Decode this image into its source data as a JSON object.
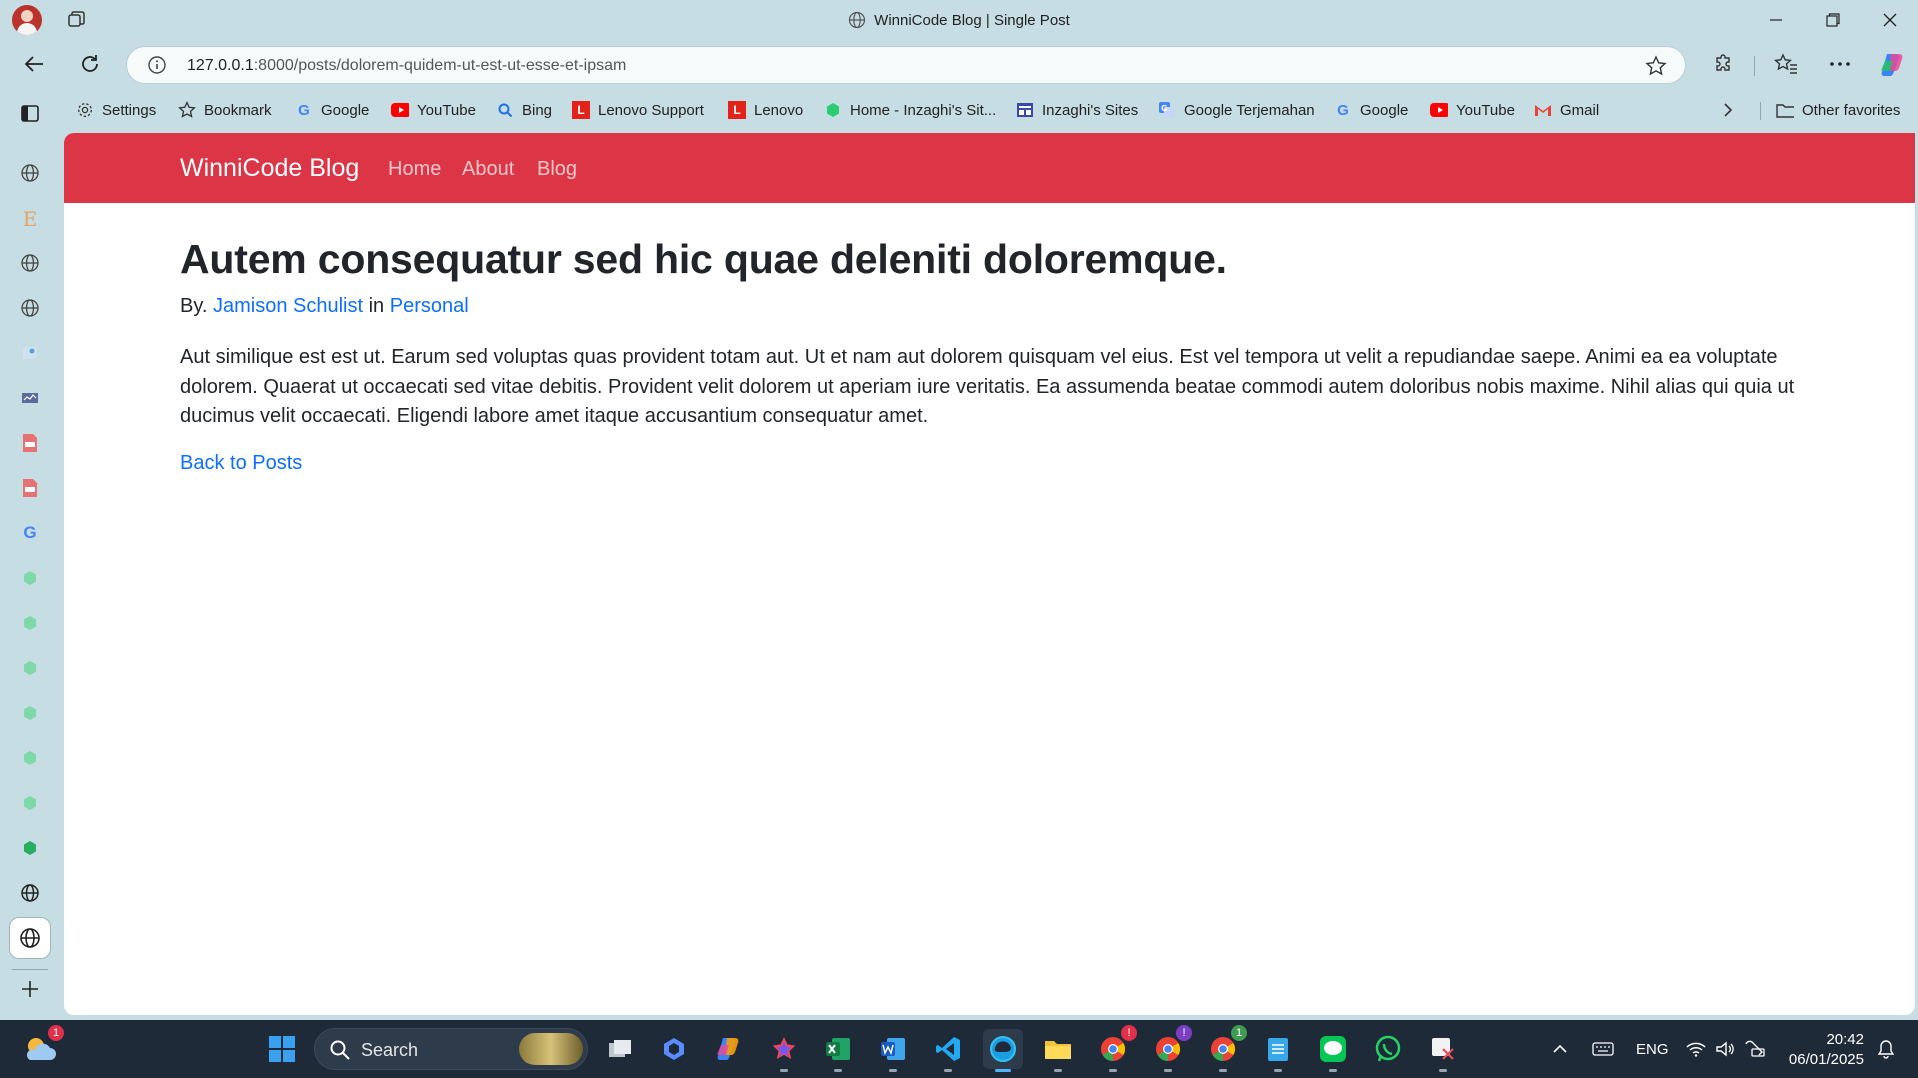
{
  "window": {
    "title": "WinniCode Blog | Single Post"
  },
  "address_bar": {
    "url_host": "127.0.0.1",
    "url_rest": ":8000/posts/dolorem-quidem-ut-est-ut-esse-et-ipsam"
  },
  "favorites": [
    {
      "label": "Settings",
      "icon": "gear-icon"
    },
    {
      "label": "Bookmark",
      "icon": "star-icon"
    },
    {
      "label": "Google",
      "icon": "google-icon"
    },
    {
      "label": "YouTube",
      "icon": "youtube-icon"
    },
    {
      "label": "Bing",
      "icon": "bing-icon"
    },
    {
      "label": "Lenovo Support",
      "icon": "lenovo-icon"
    },
    {
      "label": "Lenovo",
      "icon": "lenovo-icon"
    },
    {
      "label": "Home - Inzaghi's Sit...",
      "icon": "hexagon-icon"
    },
    {
      "label": "Inzaghi's Sites",
      "icon": "site-icon"
    },
    {
      "label": "Google Terjemahan",
      "icon": "translate-icon"
    },
    {
      "label": "Google",
      "icon": "google-icon"
    },
    {
      "label": "YouTube",
      "icon": "youtube-icon"
    },
    {
      "label": "Gmail",
      "icon": "gmail-icon"
    }
  ],
  "other_favorites": "Other favorites",
  "site": {
    "brand": "WinniCode Blog",
    "nav": [
      "Home",
      "About",
      "Blog"
    ]
  },
  "post": {
    "title": "Autem consequatur sed hic quae deleniti doloremque.",
    "by_prefix": "By.",
    "author": "Jamison Schulist",
    "in_word": "in",
    "category": "Personal",
    "body": "Aut similique est est ut. Earum sed voluptas quas provident totam aut. Ut et nam aut dolorem quisquam vel eius. Est vel tempora ut velit a repudiandae saepe. Animi ea ea voluptate dolorem. Quaerat ut occaecati sed vitae debitis. Provident velit dolorem ut aperiam iure veritatis. Ea assumenda beatae commodi autem doloribus nobis maxime. Nihil alias qui quia ut ducimus velit occaecati. Eligendi labore amet itaque accusantium consequatur amet.",
    "back_link": "Back to Posts"
  },
  "taskbar": {
    "search_placeholder": "Search",
    "weather_badge": "1",
    "chrome_badges": [
      "!",
      "!",
      "1"
    ],
    "language": "ENG",
    "time": "20:42",
    "date": "06/01/2025"
  },
  "colors": {
    "navbar": "#dc3545",
    "link": "#0d6efd",
    "chrome_bg": "#c6dde3",
    "taskbar": "#1e2a38"
  }
}
